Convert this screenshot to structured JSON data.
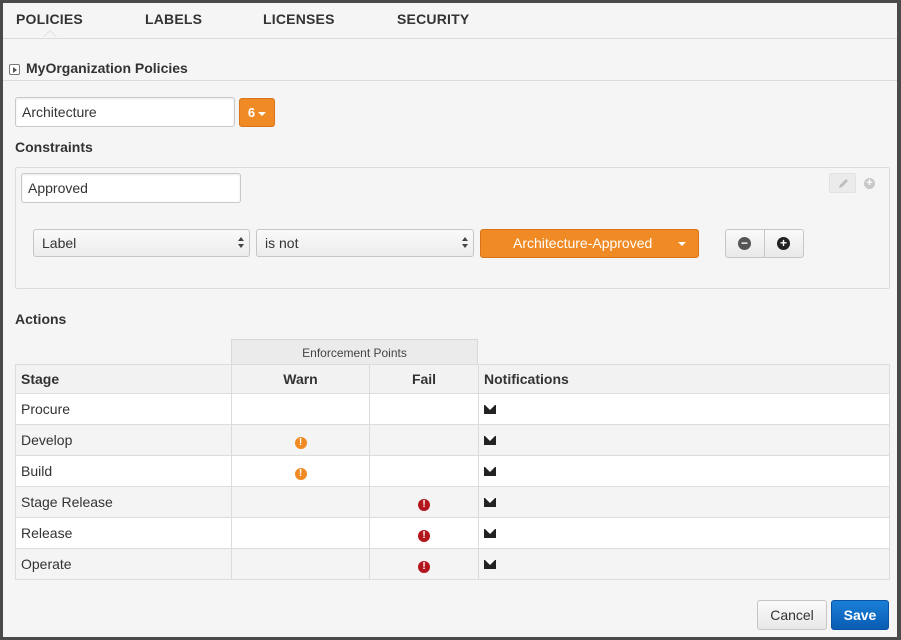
{
  "tabs": [
    {
      "label": "POLICIES",
      "active": true
    },
    {
      "label": "LABELS",
      "active": false
    },
    {
      "label": "LICENSES",
      "active": false
    },
    {
      "label": "SECURITY",
      "active": false
    }
  ],
  "section_title": "MyOrganization Policies",
  "policy": {
    "name_value": "Architecture",
    "count_badge": "6"
  },
  "constraints": {
    "heading": "Constraints",
    "name_value": "Approved",
    "condition": {
      "field": "Label",
      "operator": "is not",
      "value": "Architecture-Approved"
    },
    "remove_symbol": "−",
    "add_symbol": "+"
  },
  "actions": {
    "heading": "Actions",
    "enforcement_header": "Enforcement Points",
    "columns": {
      "stage": "Stage",
      "warn": "Warn",
      "fail": "Fail",
      "notifications": "Notifications"
    },
    "rows": [
      {
        "stage": "Procure",
        "warn": false,
        "fail": false,
        "notify": true
      },
      {
        "stage": "Develop",
        "warn": true,
        "fail": false,
        "notify": true
      },
      {
        "stage": "Build",
        "warn": true,
        "fail": false,
        "notify": true
      },
      {
        "stage": "Stage Release",
        "warn": false,
        "fail": true,
        "notify": true
      },
      {
        "stage": "Release",
        "warn": false,
        "fail": true,
        "notify": true
      },
      {
        "stage": "Operate",
        "warn": false,
        "fail": true,
        "notify": true
      }
    ]
  },
  "footer": {
    "cancel_label": "Cancel",
    "save_label": "Save"
  },
  "colors": {
    "accent_orange": "#f08a24",
    "fail_red": "#b3151d",
    "save_blue": "#0a6cc8"
  },
  "icons": {
    "collapse": "collapse-toggle-icon",
    "edit": "pencil-icon",
    "warn": "warning-icon",
    "fail": "error-icon",
    "notify": "envelope-icon"
  }
}
